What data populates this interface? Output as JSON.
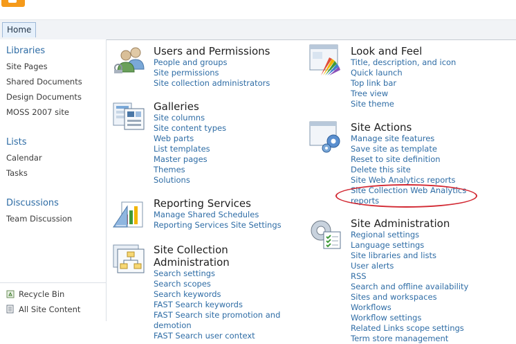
{
  "ribbon": {
    "home_tab": "Home"
  },
  "quicklaunch": {
    "libraries": {
      "heading": "Libraries",
      "items": [
        "Site Pages",
        "Shared Documents",
        "Design Documents",
        "MOSS 2007 site"
      ]
    },
    "lists": {
      "heading": "Lists",
      "items": [
        "Calendar",
        "Tasks"
      ]
    },
    "discussions": {
      "heading": "Discussions",
      "items": [
        "Team Discussion"
      ]
    },
    "bottom": {
      "recycle_bin": "Recycle Bin",
      "all_site_content": "All Site Content"
    }
  },
  "sections": {
    "users_permissions": {
      "title": "Users and Permissions",
      "icon": "users-icon",
      "links": [
        "People and groups",
        "Site permissions",
        "Site collection administrators"
      ]
    },
    "galleries": {
      "title": "Galleries",
      "icon": "galleries-icon",
      "links": [
        "Site columns",
        "Site content types",
        "Web parts",
        "List templates",
        "Master pages",
        "Themes",
        "Solutions"
      ]
    },
    "reporting_services": {
      "title": "Reporting Services",
      "icon": "reporting-icon",
      "links": [
        "Manage Shared Schedules",
        "Reporting Services Site Settings"
      ]
    },
    "site_collection_admin": {
      "title_line1": "Site Collection",
      "title_line2": "Administration",
      "icon": "site-collection-icon",
      "links": [
        "Search settings",
        "Search scopes",
        "Search keywords",
        "FAST Search keywords",
        "FAST Search site promotion and",
        "demotion",
        "FAST Search user context"
      ]
    },
    "look_feel": {
      "title": "Look and Feel",
      "icon": "look-feel-icon",
      "links": [
        "Title, description, and icon",
        "Quick launch",
        "Top link bar",
        "Tree view",
        "Site theme"
      ]
    },
    "site_actions": {
      "title": "Site Actions",
      "icon": "site-actions-icon",
      "links": [
        "Manage site features",
        "Save site as template",
        "Reset to site definition",
        "Delete this site",
        "Site Web Analytics reports",
        "Site Collection Web Analytics",
        "reports"
      ]
    },
    "site_administration": {
      "title": "Site Administration",
      "icon": "site-admin-icon",
      "links": [
        "Regional settings",
        "Language settings",
        "Site libraries and lists",
        "User alerts",
        "RSS",
        "Search and offline availability",
        "Sites and workspaces",
        "Workflows",
        "Workflow settings",
        "Related Links scope settings",
        "Term store management"
      ]
    }
  },
  "colors": {
    "link": "#2e6ca5",
    "heading": "#1f1f1f",
    "highlight": "#d22832",
    "brand": "#f59a1a"
  }
}
